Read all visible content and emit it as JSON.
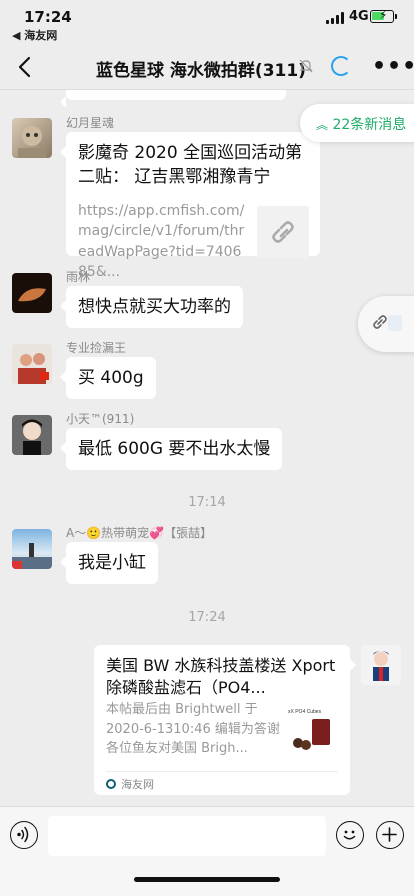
{
  "status_bar": {
    "time": "17:24",
    "back_app": "◀ 海友网",
    "network": "4G"
  },
  "nav": {
    "title": "蓝色星球 海水微拍群(311)"
  },
  "new_messages": "22条新消息",
  "messages": [
    {
      "sender": "幻月星魂",
      "type": "link",
      "title": "影魔奇 2020 全国巡回活动第二贴： 辽吉黑鄂湘豫青宁",
      "url": "https://app.cmfish.com/mag/circle/v1/forum/threadWapPage?tid=740685&..."
    },
    {
      "sender": "雨林",
      "type": "text",
      "text": "想快点就买大功率的"
    },
    {
      "sender": "专业捡漏王",
      "type": "text",
      "text": "买 400g"
    },
    {
      "sender": "小天™(911)",
      "type": "text",
      "text": "最低 600G 要不出水太慢"
    },
    {
      "sender": "A～🙂热带萌宠💞【張喆】",
      "type": "text",
      "text": "我是小缸"
    },
    {
      "sender": "",
      "type": "card",
      "title": "美国 BW 水族科技盖楼送 Xport 除磷酸盐滤石（PO4...",
      "desc": "本帖最后由 Brightwell 于 2020-6-1310:46 编辑为答谢各位鱼友对美国 Brigh...",
      "source": "海友网",
      "thumb_label": "xX PO4 Cubes"
    }
  ],
  "timestamps": [
    "17:14",
    "17:24"
  ],
  "input": {
    "placeholder": ""
  },
  "colors": {
    "accent": "#1fad6a",
    "background": "#ededed",
    "loading": "#2aa3ea"
  }
}
